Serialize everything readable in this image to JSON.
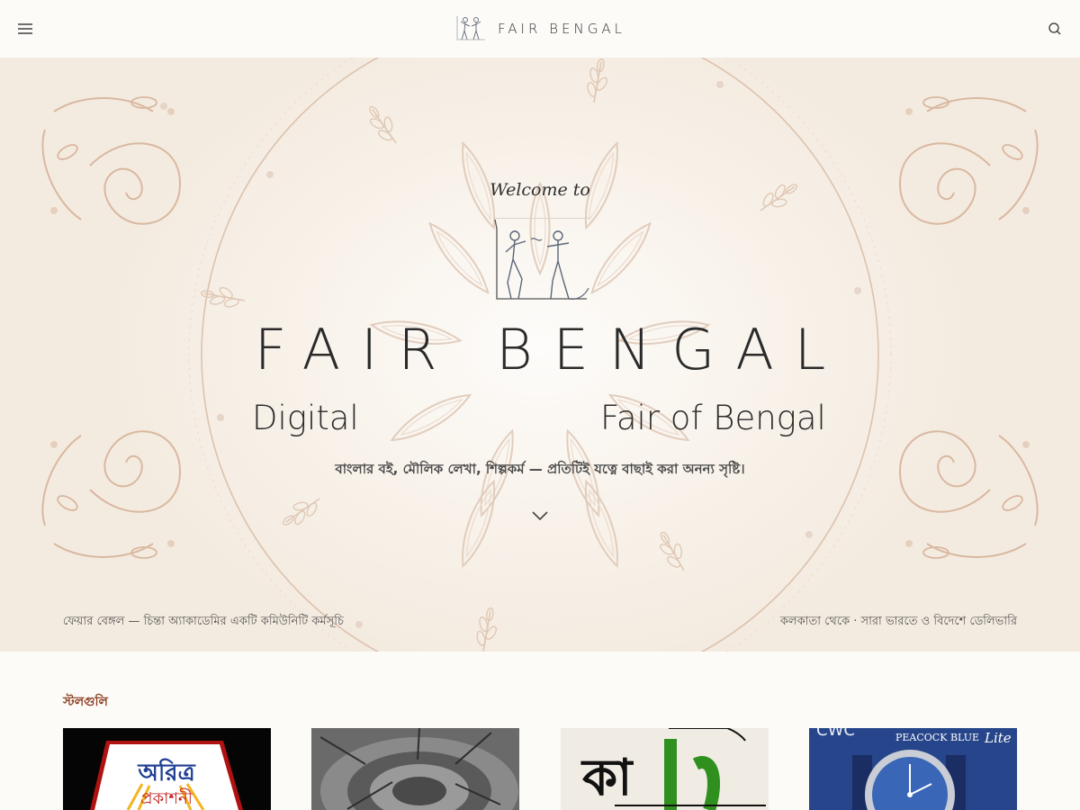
{
  "header": {
    "brand_name": "FAIR BENGAL",
    "menu_icon": "hamburger-menu-icon",
    "search_icon": "search-icon",
    "logo_icon": "dancing-figures-logo"
  },
  "hero": {
    "welcome_text": "Welcome to",
    "title": "FAIR BENGAL",
    "tagline_left": "Digital",
    "tagline_right": "Fair of Bengal",
    "subtitle": "বাংলার বই, মৌলিক লেখা, শিল্পকর্ম — প্রতিটিই যত্নে বাছাই করা অনন্য সৃষ্টি।",
    "scroll_icon": "chevron-down-icon",
    "footer_left": "ফেয়ার বেঙ্গল — চিন্তা অ্যাকাডেমির একটি কমিউনিটি কর্মসূচি",
    "footer_right": "কলকাতা থেকে · সারা ভারতে ও বিদেশে ডেলিভারি"
  },
  "stalls": {
    "heading": "স্টলগুলি",
    "items": [
      {
        "label": "অরিত্র",
        "sublabel": "প্রকাশনী"
      },
      {
        "label": ""
      },
      {
        "label": "কা"
      },
      {
        "label": "CWC",
        "sublabel": "PEACOCK BLUE",
        "badge": "Lite"
      }
    ]
  },
  "colors": {
    "background": "#fcfbf8",
    "hero_ornament": "#d9b8a0",
    "accent_heading": "#8a3b1e",
    "text": "#2a2a2a"
  }
}
